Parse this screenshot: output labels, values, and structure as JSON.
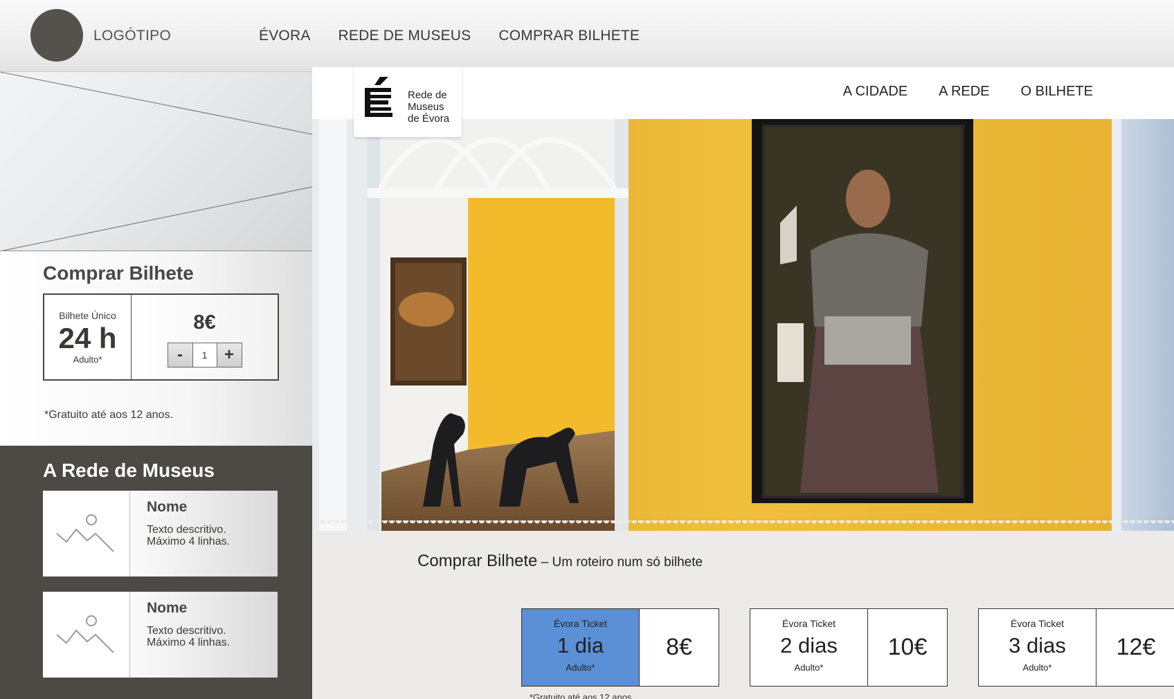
{
  "wireframe": {
    "logo_text": "LOGÓTIPO",
    "nav": [
      "ÉVORA",
      "REDE DE MUSEUS",
      "COMPRAR BILHETE"
    ],
    "buy": {
      "title": "Comprar Bilhete",
      "ticket_type": "Bilhete Único",
      "duration": "24 h",
      "audience": "Adulto*",
      "price": "8€",
      "minus": "-",
      "quantity": "1",
      "plus": "+",
      "note": "*Gratuito até aos 12 anos."
    },
    "network": {
      "title": "A Rede de Museus",
      "cards": [
        {
          "name": "Nome",
          "desc": "Texto descritivo. Máximo 4 linhas."
        },
        {
          "name": "Nome",
          "desc": "Texto descritivo. Máximo 4 linhas."
        }
      ]
    }
  },
  "site": {
    "brand": {
      "mark": "É",
      "line1": "Rede de",
      "line2": "Museus",
      "line3": "de Évora"
    },
    "nav": [
      "A CIDADE",
      "A REDE",
      "O BILHETE"
    ],
    "buy_title": "Comprar Bilhete",
    "buy_subtitle": " – Um roteiro num só bilhete",
    "tickets": [
      {
        "label": "Évora Ticket",
        "duration": "1 dia",
        "audience": "Adulto*",
        "price": "8€",
        "selected": true
      },
      {
        "label": "Évora Ticket",
        "duration": "2 dias",
        "audience": "Adulto*",
        "price": "10€",
        "selected": false
      },
      {
        "label": "Évora Ticket",
        "duration": "3 dias",
        "audience": "Adulto*",
        "price": "12€",
        "selected": false
      }
    ],
    "note": "*Gratuito até aos 12 anos"
  },
  "colors": {
    "dark_panel": "#4d4945",
    "selected_ticket": "#5b8fd6",
    "wall_yellow": "#e9b736"
  }
}
